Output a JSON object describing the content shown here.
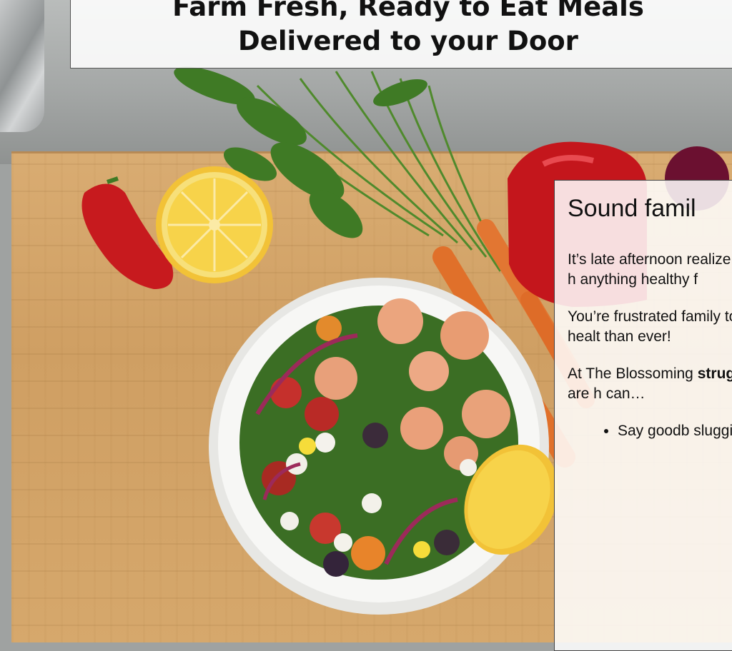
{
  "header": {
    "line1": "Farm Fresh, Ready to Eat Meals",
    "line2": "Delivered to your Door"
  },
  "panel": {
    "heading": "Sound famil",
    "p1": "It’s late afternoon realize you don’t h anything healthy f",
    "p2": "You’re frustrated family to eat healt than ever!",
    "p3_lead": "At The Blossoming",
    "p3_bold": "struggle",
    "p3_tail": "and are h can…",
    "bullet1": "Say goodb sluggishne"
  },
  "colors": {
    "board": "#d6a86c",
    "steel": "#a4a7a6",
    "bowl": "#f4f4f2",
    "lemon": "#f7d34a",
    "pepper": "#c4161c",
    "carrot": "#e0702a",
    "greens": "#3f7a25"
  }
}
